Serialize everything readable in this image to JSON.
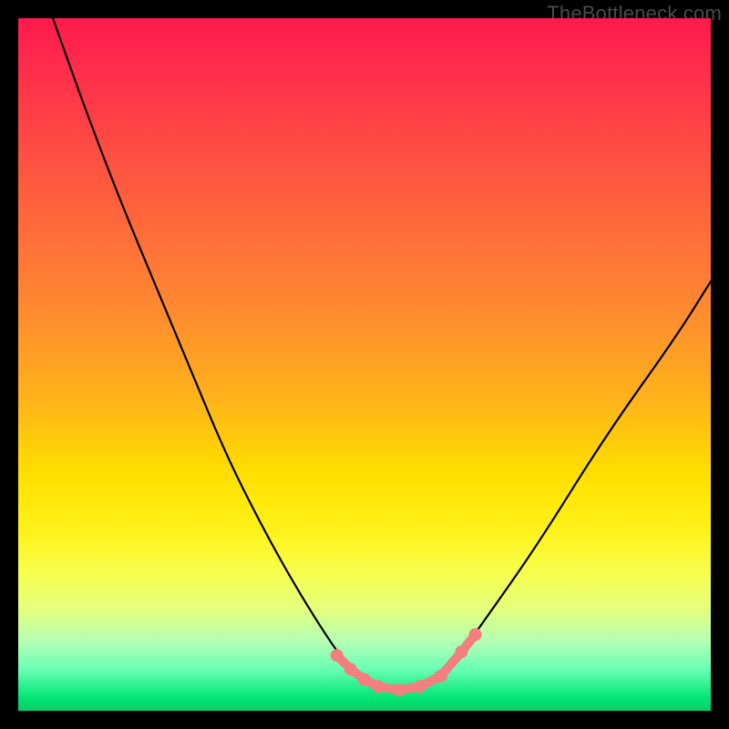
{
  "watermark": "TheBottleneck.com",
  "chart_data": {
    "type": "line",
    "title": "",
    "xlabel": "",
    "ylabel": "",
    "xlim": [
      0,
      100
    ],
    "ylim": [
      0,
      100
    ],
    "series": [
      {
        "name": "bottleneck-curve",
        "x": [
          5,
          10,
          15,
          20,
          25,
          30,
          35,
          40,
          45,
          48,
          50,
          52,
          55,
          60,
          63,
          68,
          75,
          85,
          95,
          100
        ],
        "y": [
          100,
          86,
          73,
          61,
          49,
          37,
          27,
          18,
          10,
          6,
          4,
          3,
          3,
          4,
          7,
          14,
          24,
          40,
          54,
          62
        ]
      }
    ],
    "markers": {
      "name": "bottleneck-range-markers",
      "color": "#f37d7d",
      "points": [
        {
          "x": 46,
          "y": 8
        },
        {
          "x": 48,
          "y": 6
        },
        {
          "x": 50,
          "y": 4.5
        },
        {
          "x": 52,
          "y": 3.5
        },
        {
          "x": 55,
          "y": 3
        },
        {
          "x": 58,
          "y": 3.5
        },
        {
          "x": 61,
          "y": 5
        },
        {
          "x": 64,
          "y": 8.5
        },
        {
          "x": 66,
          "y": 11
        }
      ]
    },
    "colors": {
      "curve": "#000000",
      "marker": "#f37d7d",
      "frame": "#000000"
    }
  }
}
